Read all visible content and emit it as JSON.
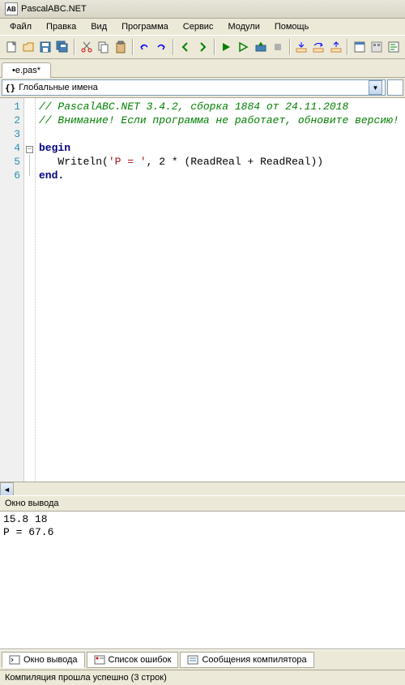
{
  "title": "PascalABC.NET",
  "menu": [
    "Файл",
    "Правка",
    "Вид",
    "Программа",
    "Сервис",
    "Модули",
    "Помощь"
  ],
  "tab": {
    "label": "•e.pas*"
  },
  "scope": {
    "icon": "{}",
    "label": "Глобальные имена"
  },
  "gutter": [
    "1",
    "2",
    "3",
    "4",
    "5",
    "6"
  ],
  "code": {
    "line1_comment": "// PascalABC.NET 3.4.2, сборка 1884 от 24.11.2018",
    "line2_comment": "// Внимание! Если программа не работает, обновите версию!",
    "line3": "",
    "line4_begin": "begin",
    "line5_body": "   Writeln('P = ', 2 * (ReadReal + ReadReal))",
    "line5_str": "'P = '",
    "line5_pre": "   Writeln(",
    "line5_mid": ", 2 * (ReadReal + ReadReal))",
    "line6_end": "end."
  },
  "output": {
    "header": "Окно вывода",
    "line1": "15.8 18",
    "line2": "P = 67.6"
  },
  "bottom_tabs": [
    {
      "label": "Окно вывода",
      "icon": "terminal"
    },
    {
      "label": "Список ошибок",
      "icon": "error-list"
    },
    {
      "label": "Сообщения компилятора",
      "icon": "messages"
    }
  ],
  "status": "Компиляция прошла успешно (3 строк)"
}
